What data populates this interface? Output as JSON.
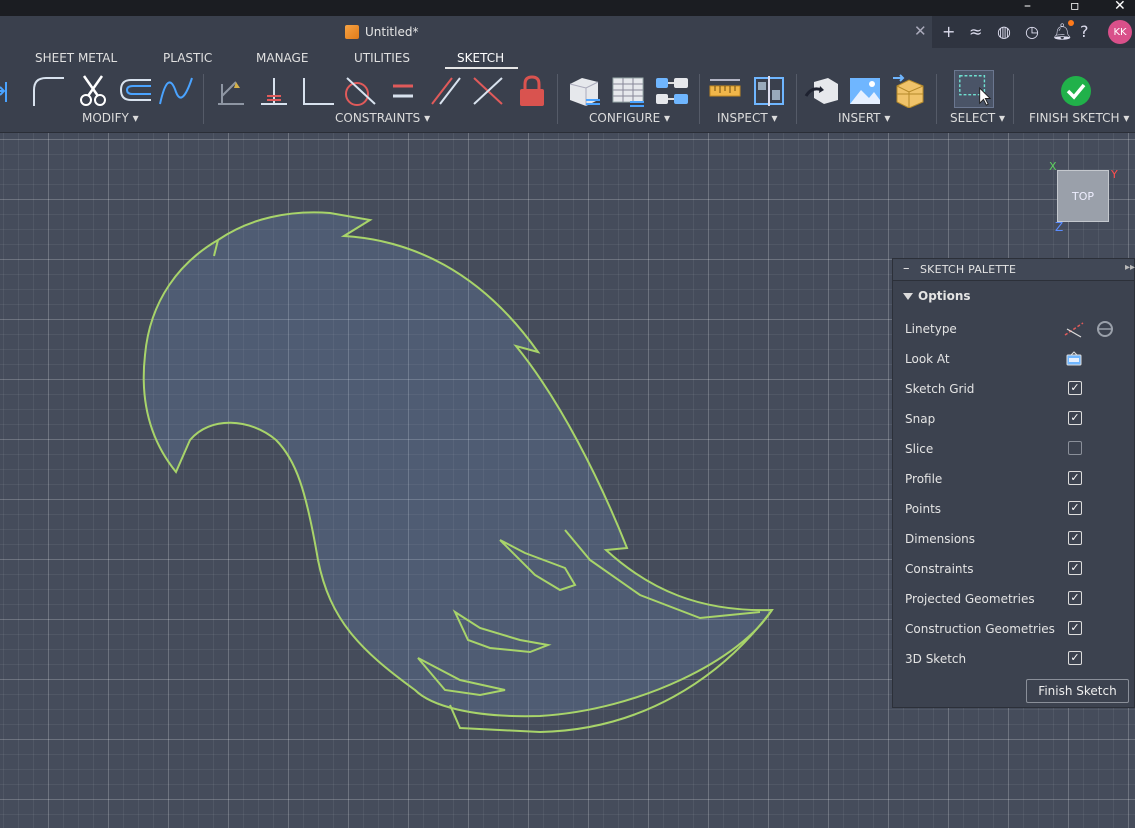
{
  "window": {
    "title": "Untitled*",
    "avatar_initials": "KK"
  },
  "ribbon": {
    "tabs": [
      {
        "label": "SHEET METAL"
      },
      {
        "label": "PLASTIC"
      },
      {
        "label": "MANAGE"
      },
      {
        "label": "UTILITIES"
      },
      {
        "label": "SKETCH",
        "active": true
      }
    ],
    "groups": {
      "modify": "MODIFY ▾",
      "constraints": "CONSTRAINTS ▾",
      "configure": "CONFIGURE ▾",
      "inspect": "INSPECT ▾",
      "insert": "INSERT ▾",
      "select": "SELECT ▾",
      "finish": "FINISH SKETCH ▾"
    }
  },
  "viewcube": {
    "face": "TOP",
    "x": "X",
    "y": "Y",
    "z": "Z"
  },
  "palette": {
    "title": "SKETCH PALETTE",
    "section": "Options",
    "rows": [
      {
        "label": "Linetype",
        "kind": "icons"
      },
      {
        "label": "Look At",
        "kind": "icon"
      },
      {
        "label": "Sketch Grid",
        "checked": true
      },
      {
        "label": "Snap",
        "checked": true
      },
      {
        "label": "Slice",
        "checked": false
      },
      {
        "label": "Profile",
        "checked": true
      },
      {
        "label": "Points",
        "checked": true
      },
      {
        "label": "Dimensions",
        "checked": true
      },
      {
        "label": "Constraints",
        "checked": true
      },
      {
        "label": "Projected Geometries",
        "checked": true
      },
      {
        "label": "Construction Geometries",
        "checked": true
      },
      {
        "label": "3D Sketch",
        "checked": true
      }
    ],
    "finish_button": "Finish Sketch"
  },
  "colors": {
    "sketch_line": "#a8d46a",
    "accent_check": "#21b14a"
  }
}
